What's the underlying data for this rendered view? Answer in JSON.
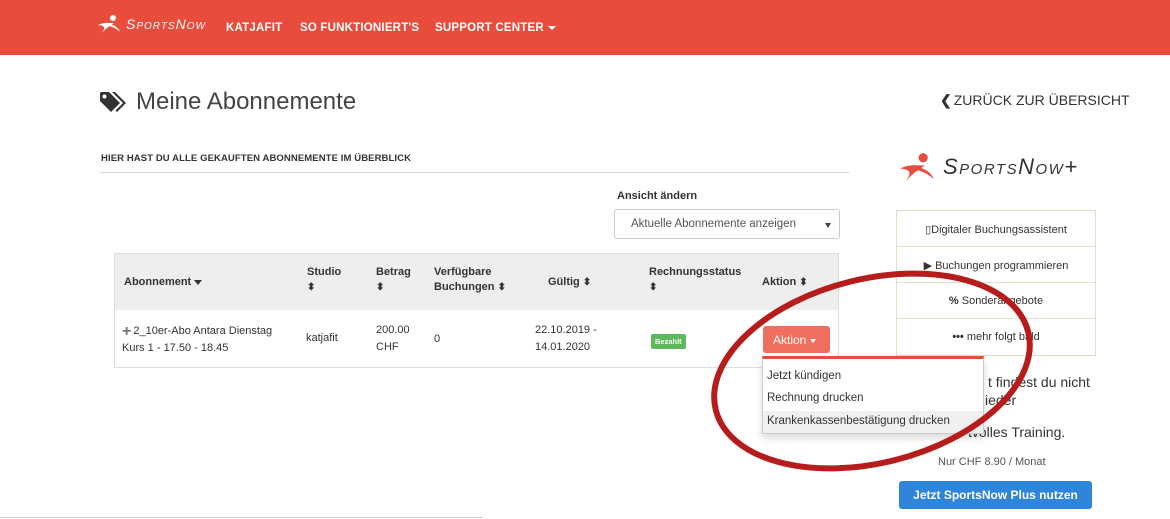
{
  "nav": {
    "brand": "SportsNow",
    "links": [
      "KATJAFIT",
      "SO FUNKTIONIERT'S",
      "SUPPORT CENTER"
    ]
  },
  "page": {
    "title": "Meine Abonnemente",
    "back": "ZURÜCK ZUR ÜBERSICHT",
    "subheading": "HIER HAST DU ALLE GEKAUFTEN ABONNEMENTE IM ÜBERBLICK"
  },
  "view": {
    "label": "Ansicht ändern",
    "selected": "Aktuelle Abonnemente anzeigen"
  },
  "table": {
    "headers": {
      "abonnement": "Abonnement",
      "studio": "Studio",
      "betrag": "Betrag",
      "verfuegbare_1": "Verfügbare",
      "verfuegbare_2": "Buchungen",
      "gueltig": "Gültig",
      "rechnungsstatus": "Rechnungsstatus",
      "aktion": "Aktion"
    },
    "row": {
      "abo_line1": "2_10er-Abo Antara Dienstag",
      "abo_line2": "Kurs 1 - 17.50 - 18.45",
      "studio": "katjafit",
      "betrag_1": "200.00",
      "betrag_2": "CHF",
      "verfuegbar": "0",
      "gueltig_1": "22.10.2019 -",
      "gueltig_2": "14.01.2020",
      "status": "Bezahlt",
      "aktion_btn": "Aktion"
    }
  },
  "dropdown": {
    "items": [
      "Jetzt kündigen",
      "Rechnung drucken",
      "Krankenkassenbestätigung drucken"
    ]
  },
  "plus": {
    "logo": "SportsNow+",
    "features": [
      "Digitaler Buchungsassistent",
      "Buchungen programmieren",
      "Sonderangebote",
      "mehr folgt bald"
    ],
    "promo1": "t findest du nicht",
    "promo2": "ieder",
    "promo3": "tvolles Training.",
    "price": "Nur CHF 8.90 / Monat",
    "cta": "Jetzt SportsNow Plus nutzen"
  },
  "colors": {
    "navbar": "#e74c3c",
    "aktion_button": "#ef6e5d",
    "badge": "#5cb85c",
    "cta": "#2e85d9",
    "annotation_circle": "#b71c1c"
  }
}
